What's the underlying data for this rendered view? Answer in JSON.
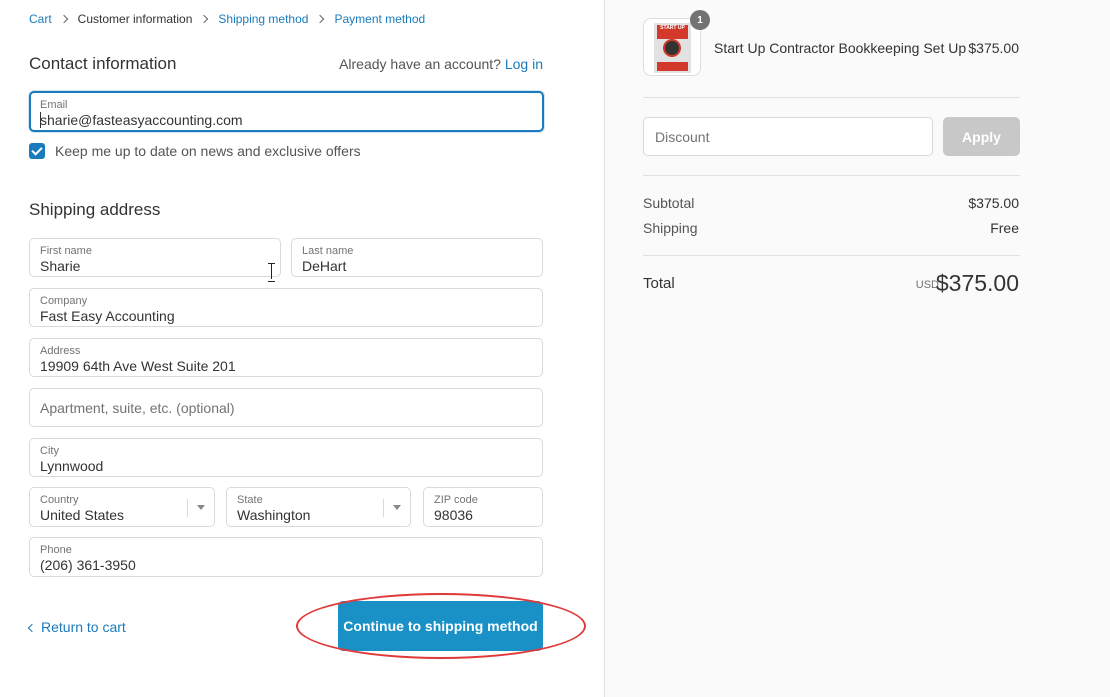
{
  "breadcrumb": {
    "items": [
      "Cart",
      "Customer information",
      "Shipping method",
      "Payment method"
    ]
  },
  "contact": {
    "title": "Contact information",
    "account_prompt": "Already have an account?",
    "login_link": "Log in",
    "email_label": "Email",
    "email_value": "sharie@fasteasyaccounting.com",
    "newsletter_label": "Keep me up to date on news and exclusive offers",
    "newsletter_checked": true
  },
  "shipping": {
    "title": "Shipping address",
    "first_name_label": "First name",
    "first_name_value": "Sharie",
    "last_name_label": "Last name",
    "last_name_value": "DeHart",
    "company_label": "Company",
    "company_value": "Fast Easy Accounting",
    "address_label": "Address",
    "address_value": "19909 64th Ave West Suite 201",
    "apartment_placeholder": "Apartment, suite, etc. (optional)",
    "city_label": "City",
    "city_value": "Lynnwood",
    "country_label": "Country",
    "country_value": "United States",
    "state_label": "State",
    "state_value": "Washington",
    "zip_label": "ZIP code",
    "zip_value": "98036",
    "phone_label": "Phone",
    "phone_value": "(206) 361-3950"
  },
  "actions": {
    "return_label": "Return to cart",
    "continue_label": "Continue to shipping method"
  },
  "summary": {
    "product_name": "Start Up Contractor Bookkeeping Set Up",
    "product_price": "$375.00",
    "quantity_badge": "1",
    "thumb_text": "START UP",
    "discount_placeholder": "Discount",
    "apply_label": "Apply",
    "subtotal_label": "Subtotal",
    "subtotal_value": "$375.00",
    "shipping_label": "Shipping",
    "shipping_value": "Free",
    "total_label": "Total",
    "currency": "USD",
    "total_value": "$375.00"
  },
  "colors": {
    "accent": "#197bbd",
    "button": "#1990c6",
    "annotation": "#e03a3a"
  }
}
